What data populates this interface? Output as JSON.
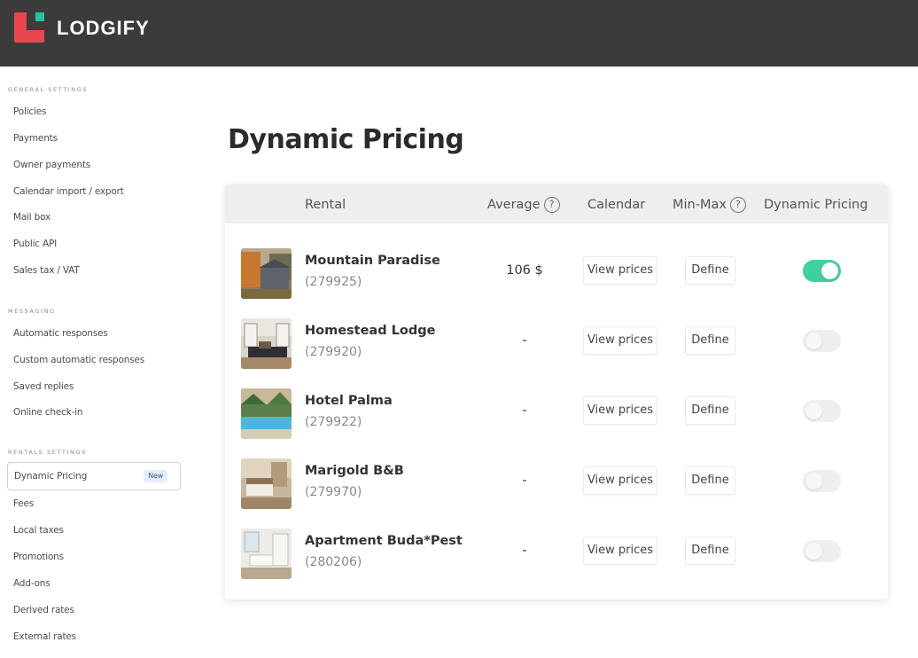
{
  "brand": {
    "name": "LODGIFY",
    "colors": {
      "red": "#e9474f",
      "green": "#27c2a0",
      "header_bg": "#3b3b3b"
    }
  },
  "sidebar": {
    "general_title": "GENERAL SETTINGS",
    "general": [
      "Policies",
      "Payments",
      "Owner payments",
      "Calendar import / export",
      "Mail box",
      "Public API",
      "Sales tax / VAT"
    ],
    "messaging_title": "MESSAGING",
    "messaging": [
      "Automatic responses",
      "Custom automatic responses",
      "Saved replies",
      "Online check-in"
    ],
    "rentals_title": "RENTALS SETTINGS",
    "rentals": [
      "Dynamic Pricing",
      "Fees",
      "Local taxes",
      "Promotions",
      "Add-ons",
      "Derived rates",
      "External rates"
    ],
    "active_badge": "New"
  },
  "page": {
    "title": "Dynamic Pricing"
  },
  "table": {
    "headers": {
      "rental": "Rental",
      "average": "Average",
      "calendar": "Calendar",
      "minmax": "Min-Max",
      "dynamic": "Dynamic Pricing"
    },
    "help_icon": "question-circle-icon",
    "rows": [
      {
        "name": "Mountain Paradise",
        "id": "(279925)",
        "average": "106 $",
        "calendar": "View prices",
        "minmax": "Define",
        "enabled": true
      },
      {
        "name": "Homestead Lodge",
        "id": "(279920)",
        "average": "-",
        "calendar": "View prices",
        "minmax": "Define",
        "enabled": false
      },
      {
        "name": "Hotel Palma",
        "id": "(279922)",
        "average": "-",
        "calendar": "View prices",
        "minmax": "Define",
        "enabled": false
      },
      {
        "name": "Marigold B&B",
        "id": "(279970)",
        "average": "-",
        "calendar": "View prices",
        "minmax": "Define",
        "enabled": false
      },
      {
        "name": "Apartment Buda*Pest",
        "id": "(280206)",
        "average": "-",
        "calendar": "View prices",
        "minmax": "Define",
        "enabled": false
      }
    ],
    "toggle_on_color": "#3fd09d"
  }
}
